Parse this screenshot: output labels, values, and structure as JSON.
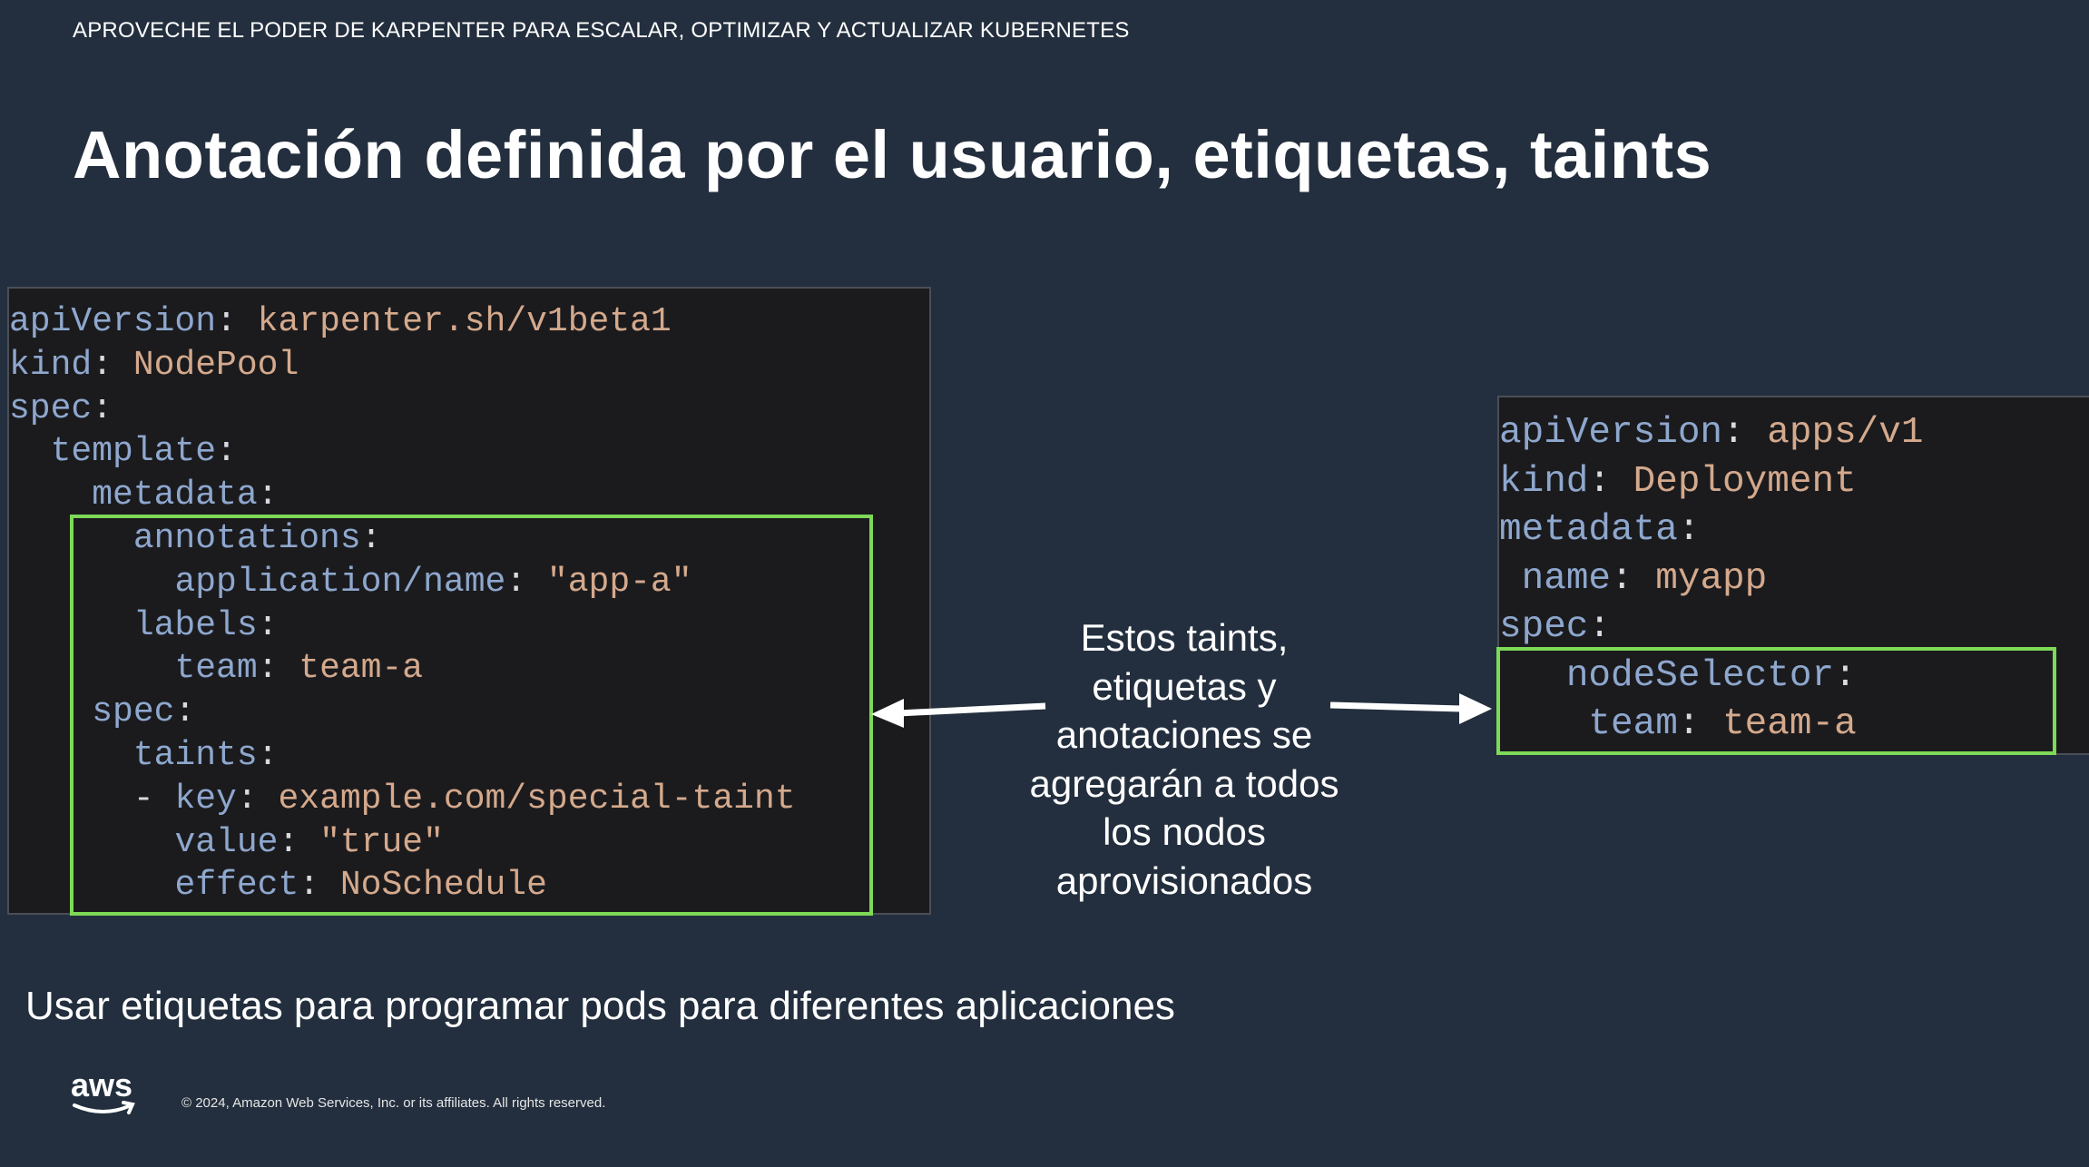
{
  "header": {
    "kicker": "APROVECHE EL PODER DE KARPENTER PARA ESCALAR, OPTIMIZAR Y ACTUALIZAR KUBERNETES",
    "title": "Anotación definida por el usuario, etiquetas, taints"
  },
  "code_left": {
    "lines": [
      {
        "indent": "",
        "key": "apiVersion",
        "sep": ": ",
        "value": "karpenter.sh/v1beta1"
      },
      {
        "indent": "",
        "key": "kind",
        "sep": ": ",
        "value": "NodePool"
      },
      {
        "indent": "",
        "key": "spec",
        "sep": ":",
        "value": ""
      },
      {
        "indent": "  ",
        "key": "template",
        "sep": ":",
        "value": ""
      },
      {
        "indent": "    ",
        "key": "metadata",
        "sep": ":",
        "value": ""
      },
      {
        "indent": "      ",
        "key": "annotations",
        "sep": ":",
        "value": ""
      },
      {
        "indent": "        ",
        "key": "application/name",
        "sep": ": ",
        "value": "\"app-a\""
      },
      {
        "indent": "      ",
        "key": "labels",
        "sep": ":",
        "value": ""
      },
      {
        "indent": "        ",
        "key": "team",
        "sep": ": ",
        "value": "team-a"
      },
      {
        "indent": "    ",
        "key": "spec",
        "sep": ":",
        "value": ""
      },
      {
        "indent": "      ",
        "key": "taints",
        "sep": ":",
        "value": ""
      },
      {
        "indent": "      - ",
        "key": "key",
        "sep": ": ",
        "value": "example.com/special-taint"
      },
      {
        "indent": "        ",
        "key": "value",
        "sep": ": ",
        "value": "\"true\""
      },
      {
        "indent": "        ",
        "key": "effect",
        "sep": ": ",
        "value": "NoSchedule"
      }
    ]
  },
  "code_right": {
    "lines": [
      {
        "indent": "",
        "key": "apiVersion",
        "sep": ": ",
        "value": "apps/v1"
      },
      {
        "indent": "",
        "key": "kind",
        "sep": ": ",
        "value": "Deployment"
      },
      {
        "indent": "",
        "key": "metadata",
        "sep": ":",
        "value": ""
      },
      {
        "indent": " ",
        "key": "name",
        "sep": ": ",
        "value": "myapp"
      },
      {
        "indent": "",
        "key": "spec",
        "sep": ":",
        "value": ""
      },
      {
        "indent": "   ",
        "key": "nodeSelector",
        "sep": ":",
        "value": ""
      },
      {
        "indent": "    ",
        "key": "team",
        "sep": ": ",
        "value": "team-a"
      }
    ]
  },
  "caption": "Estos taints, etiquetas y anotaciones se agregarán a todos los nodos aprovisionados",
  "subtitle": "Usar etiquetas para programar pods para diferentes aplicaciones",
  "footer": {
    "logo_text": "aws",
    "copyright": "© 2024, Amazon Web Services, Inc. or its affiliates. All rights reserved."
  },
  "colors": {
    "background": "#232f3e",
    "code_background": "#1b1b1e",
    "code_key": "#8ea7cd",
    "code_value": "#d4a98c",
    "highlight": "#7ed957"
  }
}
